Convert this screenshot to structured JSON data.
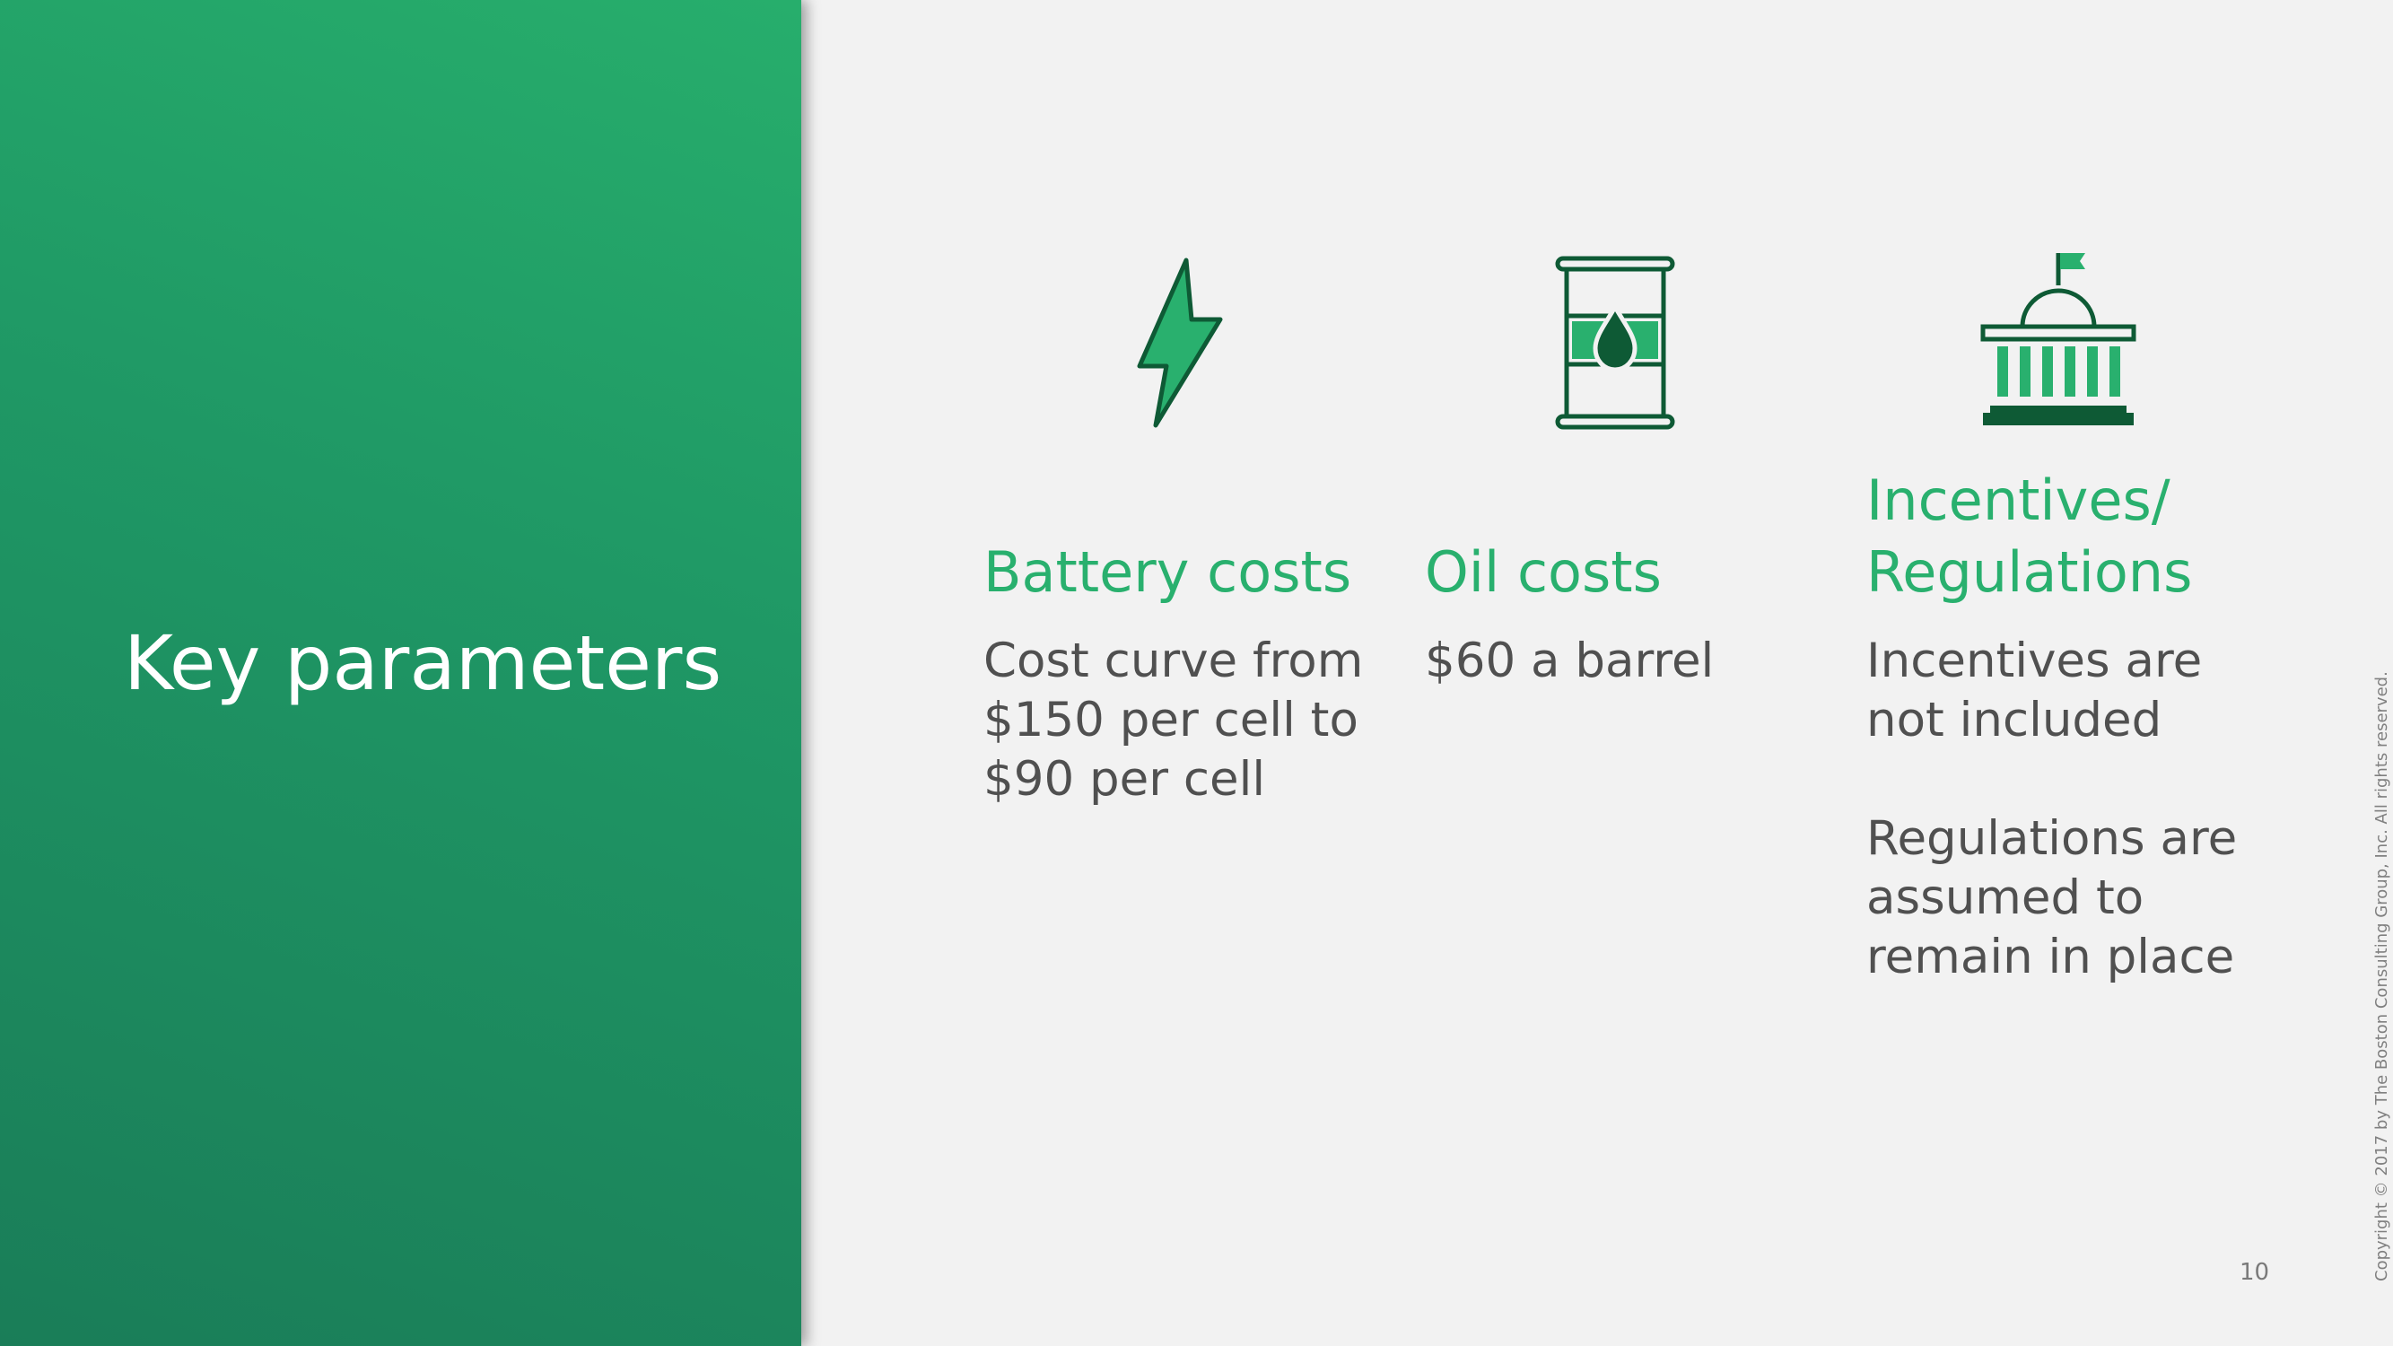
{
  "slide": {
    "title": "Key parameters",
    "page_number": "10",
    "copyright": "Copyright © 2017 by The Boston Consulting Group, Inc. All rights reserved."
  },
  "colors": {
    "accent_green": "#29b06e",
    "dark_green": "#0e5a35",
    "panel_green": "#1f9865",
    "body_text": "#505050"
  },
  "parameters": [
    {
      "icon": "lightning-bolt-icon",
      "heading_lines": [
        "Battery costs"
      ],
      "text_lines": [
        "Cost curve from",
        "$150 per cell to",
        "$90 per cell"
      ]
    },
    {
      "icon": "oil-barrel-icon",
      "heading_lines": [
        "Oil costs"
      ],
      "text_lines": [
        "$60 a barrel"
      ]
    },
    {
      "icon": "government-building-icon",
      "heading_lines": [
        "Incentives/",
        "Regulations"
      ],
      "text_lines": [
        "Incentives are",
        "not included",
        "",
        "Regulations are",
        "assumed to",
        "remain in place"
      ]
    }
  ]
}
